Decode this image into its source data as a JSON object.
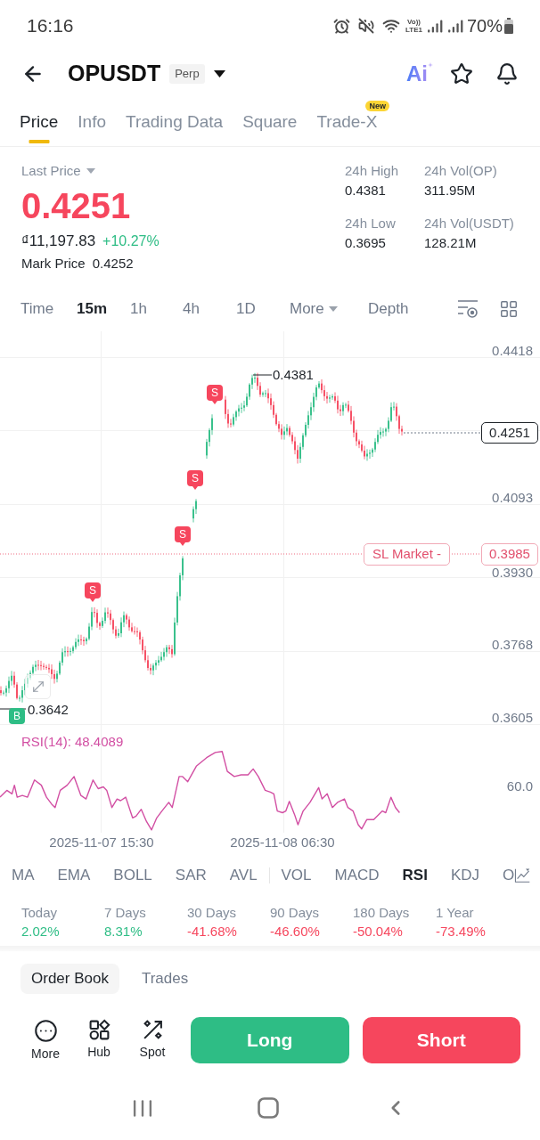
{
  "status_bar": {
    "time": "16:16",
    "volte": [
      "Vo))",
      "LTE1"
    ],
    "battery": "70%"
  },
  "header": {
    "symbol": "OPUSDT",
    "badge": "Perp",
    "ai_label": "Ai"
  },
  "tabs": [
    {
      "label": "Price",
      "selected": true
    },
    {
      "label": "Info",
      "selected": false
    },
    {
      "label": "Trading Data",
      "selected": false
    },
    {
      "label": "Square",
      "selected": false
    },
    {
      "label": "Trade-X",
      "selected": false,
      "badge": "New"
    }
  ],
  "price": {
    "label": "Last Price",
    "value": "0.4251",
    "value_rising": false,
    "fiat_value": "₫11,197.83",
    "change": "+10.27%",
    "change_rising": true,
    "mark_price_label": "Mark Price",
    "mark_price": "0.4252"
  },
  "stats": [
    {
      "label": "24h High",
      "value": "0.4381"
    },
    {
      "label": "24h Vol(OP)",
      "value": "311.95M"
    },
    {
      "label": "24h Low",
      "value": "0.3695"
    },
    {
      "label": "24h Vol(USDT)",
      "value": "128.21M"
    }
  ],
  "timeframes": [
    {
      "label": "Time",
      "kind": "option",
      "selected": false
    },
    {
      "label": "15m",
      "kind": "option",
      "selected": true
    },
    {
      "label": "1h",
      "kind": "option",
      "selected": false
    },
    {
      "label": "4h",
      "kind": "option",
      "selected": false
    },
    {
      "label": "1D",
      "kind": "option",
      "selected": false
    },
    {
      "label": "More",
      "kind": "dropdown",
      "selected": false
    },
    {
      "label": "Depth",
      "kind": "option",
      "selected": false
    }
  ],
  "chart": {
    "price_axis": [
      "0.4418",
      "0.4093",
      "0.3930",
      "0.3768",
      "0.3605"
    ],
    "high_label": "0.4381",
    "low_label": "0.3642",
    "current_price": "0.4251",
    "stop_loss": {
      "label": "SL Market -",
      "price": "0.3985"
    },
    "trade_markers": [
      {
        "kind": "sell",
        "label": "S"
      },
      {
        "kind": "sell",
        "label": "S"
      },
      {
        "kind": "sell",
        "label": "S"
      },
      {
        "kind": "sell",
        "label": "S"
      },
      {
        "kind": "buy",
        "label": "B"
      }
    ],
    "rsi": {
      "label": "RSI(14): 48.4089",
      "axis": [
        "60.0"
      ]
    },
    "time_axis": [
      "2025-11-07 15:30",
      "2025-11-08 06:30"
    ]
  },
  "indicators": {
    "main": [
      {
        "label": "MA",
        "selected": false
      },
      {
        "label": "EMA",
        "selected": false
      },
      {
        "label": "BOLL",
        "selected": false
      },
      {
        "label": "SAR",
        "selected": false
      },
      {
        "label": "AVL",
        "selected": false
      }
    ],
    "sub": [
      {
        "label": "VOL",
        "selected": false
      },
      {
        "label": "MACD",
        "selected": false
      },
      {
        "label": "RSI",
        "selected": true
      },
      {
        "label": "KDJ",
        "selected": false
      },
      {
        "label": "O",
        "selected": false
      }
    ]
  },
  "performance": [
    {
      "period": "Today",
      "value": "2.02%",
      "rising": true
    },
    {
      "period": "7 Days",
      "value": "8.31%",
      "rising": true
    },
    {
      "period": "30 Days",
      "value": "-41.68%",
      "rising": false
    },
    {
      "period": "90 Days",
      "value": "-46.60%",
      "rising": false
    },
    {
      "period": "180 Days",
      "value": "-50.04%",
      "rising": false
    },
    {
      "period": "1 Year",
      "value": "-73.49%",
      "rising": false
    }
  ],
  "book_tabs": [
    {
      "label": "Order Book",
      "selected": true
    },
    {
      "label": "Trades",
      "selected": false
    }
  ],
  "actions": [
    {
      "label": "More",
      "kind": "more"
    },
    {
      "label": "Hub",
      "kind": "hub"
    },
    {
      "label": "Spot",
      "kind": "spot"
    }
  ],
  "trade_buttons": [
    {
      "label": "Long",
      "kind": "long"
    },
    {
      "label": "Short",
      "kind": "short"
    }
  ]
}
